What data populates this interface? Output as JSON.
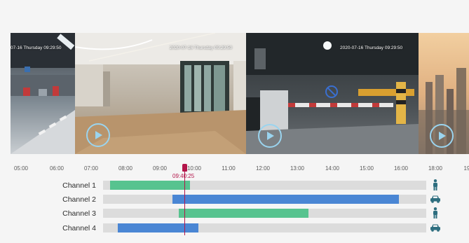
{
  "thumbnails": [
    {
      "timestamp": "07-16 Thursday 09:29:50",
      "scene": "parking-garage-left"
    },
    {
      "timestamp": "2020-07-16 Thursday 09:29:50",
      "scene": "lobby"
    },
    {
      "timestamp": "2020-07-16 Thursday 09:29:50",
      "scene": "parking-gate"
    },
    {
      "timestamp": "",
      "scene": "city-skyline"
    }
  ],
  "timeline": {
    "hours": [
      "05:00",
      "06:00",
      "07:00",
      "08:00",
      "09:00",
      "10:00",
      "11:00",
      "12:00",
      "13:00",
      "14:00",
      "15:00",
      "16:00",
      "18:00",
      "19"
    ],
    "cursor_time": "09:40:25",
    "channels": [
      {
        "label": "Channel 1",
        "icon": "person-icon",
        "color": "#57c38f",
        "start": "07:45",
        "end": "09:15"
      },
      {
        "label": "Channel 2",
        "icon": "car-icon",
        "color": "#4a86d4",
        "start": "09:30",
        "end": "16:00"
      },
      {
        "label": "Channel 3",
        "icon": "person-icon",
        "color": "#57c38f",
        "start": "09:35",
        "end": "13:20"
      },
      {
        "label": "Channel 4",
        "icon": "car-icon",
        "color": "#4a86d4",
        "start": "07:55",
        "end": "10:15"
      }
    ]
  }
}
